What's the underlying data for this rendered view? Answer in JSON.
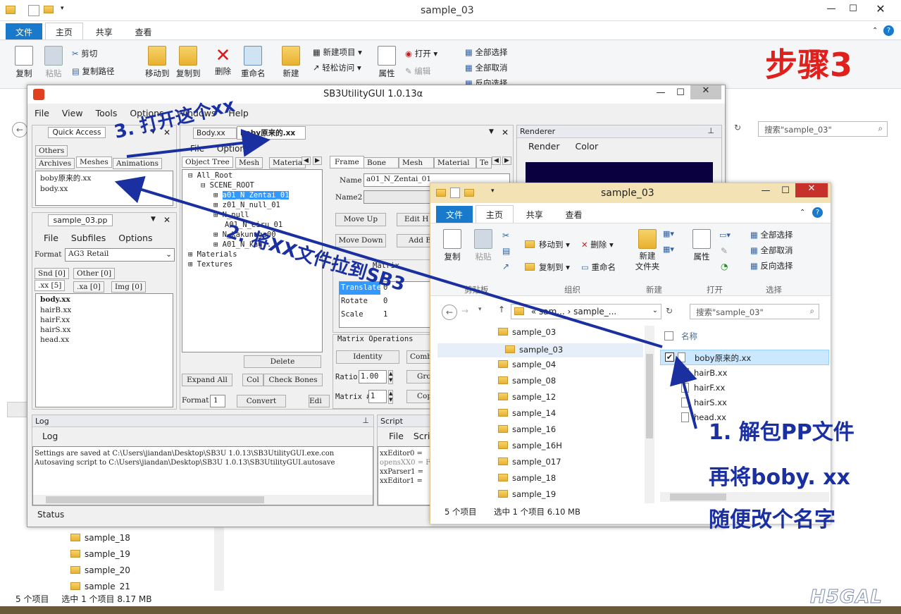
{
  "bg": {
    "title": "sample_03",
    "tabs": [
      "文件",
      "主页",
      "共享",
      "查看"
    ],
    "ribbon": {
      "copy": "复制",
      "paste": "粘贴",
      "cut": "剪切",
      "copy_path": "复制路径",
      "move_to": "移动到",
      "copy_to": "复制到",
      "delete": "删除",
      "rename": "重命名",
      "new": "新建",
      "new_item": "新建项目",
      "easy_access": "轻松访问",
      "properties": "属性",
      "open": "打开",
      "edit": "编辑",
      "select_all": "全部选择",
      "select_none": "全部取消",
      "invert": "反向选择"
    },
    "search_placeholder": "搜索\"sample_03\"",
    "nav_bottom": [
      "sample_18",
      "sample_19",
      "sample_20",
      "sample_21"
    ],
    "status_count": "5 个项目",
    "status_sel": "选中 1 个项目  8.17 MB"
  },
  "step_label": "步骤3",
  "sb3": {
    "title": "SB3UtilityGUI 1.0.13α",
    "menu": [
      "File",
      "View",
      "Tools",
      "Options",
      "Windows",
      "Help"
    ],
    "quick_access": "Quick Access",
    "qa_tabs": [
      "Others",
      "Archives",
      "Meshes",
      "Animations"
    ],
    "qa_items": [
      "boby原来的.xx",
      "body.xx"
    ],
    "pp_tab": "sample_03.pp",
    "pp_menu": [
      "File",
      "Subfiles",
      "Options"
    ],
    "format_label": "Format",
    "format_value": "AG3 Retail",
    "pp_tabs": [
      "Snd [0]",
      "Other [0]",
      ".xx [5]",
      ".xa [0]",
      "Img [0]"
    ],
    "pp_items": [
      "body.xx",
      "hairB.xx",
      "hairF.xx",
      "hairS.xx",
      "head.xx"
    ],
    "doc_tabs": [
      "Body.xx",
      "boby原来的.xx"
    ],
    "ed_menu": [
      "File",
      "Options"
    ],
    "tree_tabs": [
      "Object Tree",
      "Mesh",
      "Materia"
    ],
    "tree": [
      "All_Root",
      "SCENE_ROOT",
      "a01_N_Zentai_01",
      "z01_N_null_01",
      "N_null",
      "A01_N_eiru_01",
      "N_kakunuge00",
      "A01_N_kag...",
      "Materials",
      "Textures"
    ],
    "tree_buttons": [
      "Delete",
      "Expand All",
      "Col",
      "Check Bones"
    ],
    "format_num": "1",
    "convert": "Convert",
    "edit": "Edi",
    "prop_tabs": [
      "Frame",
      "Bone",
      "Mesh",
      "Material",
      "Te"
    ],
    "name_label": "Name",
    "name_value": "a01_N_Zentai_01",
    "name2_label": "Name2",
    "prop_buttons": [
      "Move Up",
      "Edit H",
      "Move Down",
      "Add B"
    ],
    "srt_header": "Matrix",
    "srt": [
      "Translate",
      "Rotate",
      "Scale"
    ],
    "srt_vals": [
      "0",
      "0",
      "1"
    ],
    "matrix_ops": "Matrix Operations",
    "identity": "Identity",
    "combine": "Combi",
    "ratio_label": "Ratio",
    "ratio_value": "1.00",
    "matrix_label": "Matrix #",
    "matrix_value": "1",
    "gro": "Gro",
    "cop": "Cop",
    "renderer": "Renderer",
    "renderer_menu": [
      "Render",
      "Color"
    ],
    "log_title": "Log",
    "log_menu": "Log",
    "log_lines": [
      "Settings are saved at C:\\Users\\jiandan\\Desktop\\SB3U 1.0.13\\SB3UtilityGUI.exe.con",
      "Autosaving script to C:\\Users\\jiandan\\Desktop\\SB3U 1.0.13\\SB3UtilityGUI.autosave"
    ],
    "script_title": "Script",
    "script_menu": [
      "File",
      "Scri"
    ],
    "script_lines": [
      "xxEditor0 =",
      "opensXX0 = F",
      "xxParser1 =",
      "xxEditor1 ="
    ],
    "status": "Status"
  },
  "fw": {
    "title": "sample_03",
    "tabs": [
      "文件",
      "主页",
      "共享",
      "查看"
    ],
    "ribbon": {
      "copy": "复制",
      "paste": "粘贴",
      "move_to": "移动到",
      "copy_to": "复制到",
      "delete": "删除",
      "rename": "重命名",
      "new_folder": "新建\n文件夹",
      "properties": "属性",
      "select_all": "全部选择",
      "select_none": "全部取消",
      "invert": "反向选择"
    },
    "groups": [
      "剪贴板",
      "组织",
      "新建",
      "打开",
      "选择"
    ],
    "address": [
      "« sam...",
      "sample_..."
    ],
    "search_placeholder": "搜索\"sample_03\"",
    "nav": [
      "sample_03",
      "sample_03",
      "sample_04",
      "sample_08",
      "sample_12",
      "sample_14",
      "sample_16",
      "sample_16H",
      "sample_017",
      "sample_18",
      "sample_19"
    ],
    "col_name": "名称",
    "files": [
      "boby原来的.xx",
      "hairB.xx",
      "hairF.xx",
      "hairS.xx",
      "head.xx"
    ],
    "status_count": "5 个项目",
    "status_sel": "选中 1 个项目  6.10 MB"
  },
  "annotations": {
    "a3": "3. 打开这个xx",
    "a2": "2. 将XX文件拉到SB3",
    "a1": "1. 解包PP文件",
    "a1b": "再将boby. xx",
    "a1c": "随便改个名字"
  },
  "watermark": "H5GAL"
}
